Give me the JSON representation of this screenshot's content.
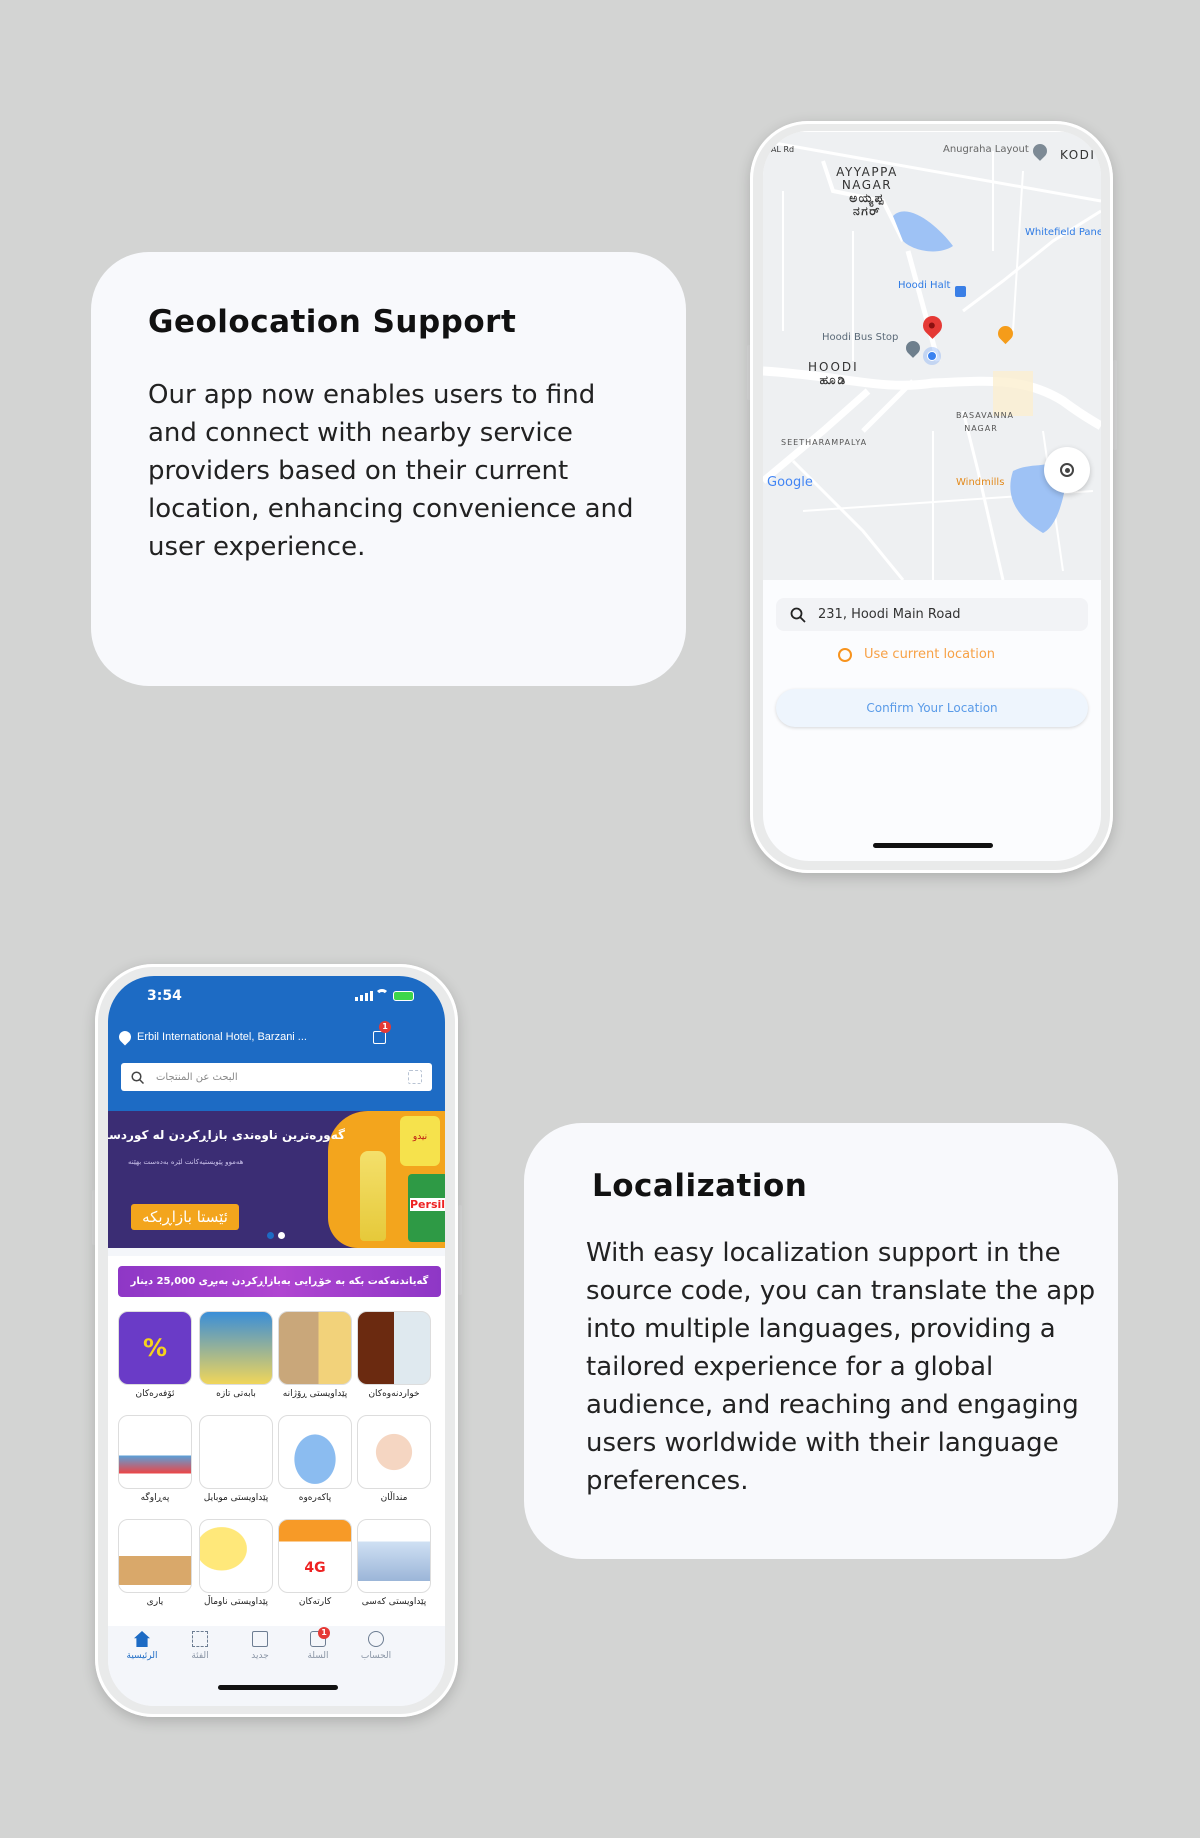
{
  "geolocation": {
    "title": "Geolocation Support",
    "body": "Our app now enables users to find and connect with nearby service providers based on their current location, enhancing convenience and user experience."
  },
  "localization": {
    "title": "Localization",
    "body": "With easy localization support in the source code, you can translate the app into multiple languages, providing a tailored experience for a global audience, and reaching and engaging users worldwide with their language preferences."
  },
  "map_screen": {
    "labels": {
      "ayyappa": "AYYAPPA NAGAR",
      "ayyappa_kn": "ಅಯ್ಯಪ್ಪ ನಗರ್",
      "anugraha": "Anugraha Layout",
      "kodi": "KODI",
      "whitefield": "Whitefield Panel",
      "hoodi_halt": "Hoodi Halt",
      "hoodi_bus": "Hoodi Bus Stop",
      "hoodi": "HOODI",
      "hoodi_kn": "ಹೂಡಿ",
      "basavanna": "BASAVANNA NAGAR",
      "seetharampalya": "SEETHARAMPALYA",
      "windmills": "Windmills",
      "hal": "HAL Rd",
      "google": "Google"
    },
    "address": "231, Hoodi Main Road",
    "use_current_location": "Use current location",
    "confirm_button": "Confirm Your Location",
    "colors": {
      "accent": "#f7931e",
      "confirm_text": "#5a9be8",
      "confirm_bg": "#eef5fd"
    }
  },
  "shop_screen": {
    "status_time": "3:54",
    "location": "Erbil International Hotel, Barzani ...",
    "cart_badge": "1",
    "search_placeholder": "البحث عن المنتجات",
    "banner": {
      "headline": "گەورەترین ناوەندی بازاڕکردن لە کوردستان",
      "subline": "هەموو پێویستیەکانت لێرە بەدەست بهێنە",
      "cta": "ئێستا بازاڕبکە",
      "products": [
        "نیدو",
        "Persil"
      ]
    },
    "promo": "گەیاندنەکەت بکە بە خۆڕایی بەبازاڕکردن بەبڕی 25,000 دینار",
    "categories": [
      {
        "label": "خواردنەوەکان",
        "icon": "drinks"
      },
      {
        "label": "پێداویستی ڕۆژانە",
        "icon": "groceries"
      },
      {
        "label": "بابەتی تازە",
        "icon": "new"
      },
      {
        "label": "ئۆفەرەکان",
        "icon": "offers",
        "glyph": "%"
      },
      {
        "label": "منداڵان",
        "icon": "baby"
      },
      {
        "label": "پاکەرەوە",
        "icon": "detergent"
      },
      {
        "label": "پێداویستی موبایل",
        "icon": "cable"
      },
      {
        "label": "پەڕاوگە",
        "icon": "stationery"
      },
      {
        "label": "پێداویستی کەسی",
        "icon": "personal-care"
      },
      {
        "label": "کارتەکان",
        "icon": "cards",
        "glyph": "4G"
      },
      {
        "label": "پێداویستی ناوماڵ",
        "icon": "lamp"
      },
      {
        "label": "یاری",
        "icon": "toys"
      }
    ],
    "nav": [
      {
        "label": "الرئيسية",
        "icon": "home",
        "active": true
      },
      {
        "label": "الفئة",
        "icon": "grid"
      },
      {
        "label": "جديد",
        "icon": "store"
      },
      {
        "label": "السلة",
        "icon": "bag",
        "badge": "1"
      },
      {
        "label": "الحساب",
        "icon": "account"
      }
    ],
    "colors": {
      "primary": "#1d6bc4",
      "banner": "#3b2d74",
      "banner_accent": "#f3a51d",
      "promo": "#a33bc9",
      "badge": "#e53935"
    }
  }
}
